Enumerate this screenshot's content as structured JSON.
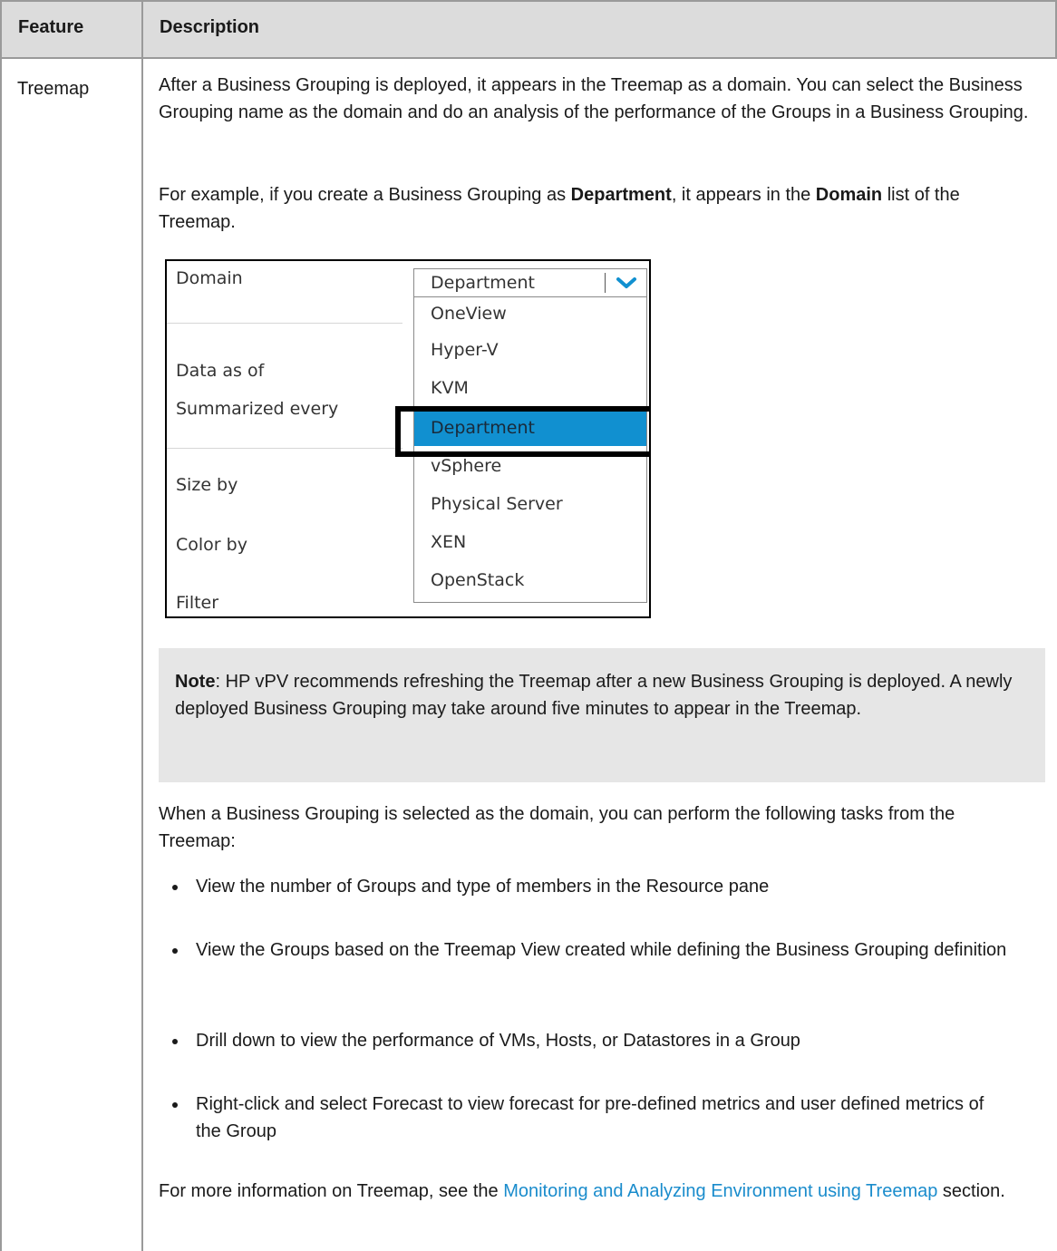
{
  "table": {
    "headers": [
      "Feature",
      "Description"
    ],
    "feature": "Treemap"
  },
  "paragraphs": {
    "p1": "After a Business Grouping is deployed, it appears in the Treemap as a domain. You can select the Business Grouping name as the domain and do an analysis of the performance of the Groups in a Business Grouping.",
    "p2_pre": "For example, if you create a Business Grouping as ",
    "p2_b1": "Department",
    "p2_mid": ", it appears in the ",
    "p2_b2": "Domain",
    "p2_post": " list of the Treemap.",
    "p3": "When a Business Grouping is selected as the domain, you can perform the following tasks from the Treemap:",
    "p4_pre": "For more information on Treemap, see the ",
    "p4_link": "Monitoring and Analyzing Environment using Treemap",
    "p4_post": " section."
  },
  "screenshot": {
    "labels": [
      "Domain",
      "Data as of",
      "Summarized every",
      "Size by",
      "Color by",
      "Filter"
    ],
    "selected_value": "Department",
    "options": [
      "OneView",
      "Hyper-V",
      "KVM",
      "Department",
      "vSphere",
      "Physical Server",
      "XEN",
      "OpenStack"
    ],
    "highlighted_option": "Department",
    "highlight_color": "#1190d0"
  },
  "note": {
    "label": "Note",
    "text": ": HP vPV recommends refreshing the Treemap after a new Business Grouping is deployed. A newly deployed Business Grouping may take around five minutes to appear in the Treemap."
  },
  "bullets": [
    "View the number of Groups and type of members in the Resource pane",
    "View the Groups based on the Treemap View created while defining the Business Grouping definition",
    "Drill down to view the performance of VMs, Hosts, or Datastores in a Group",
    "Right-click and select Forecast to view forecast for pre-defined metrics and user defined metrics of the Group"
  ],
  "colors": {
    "header_bg": "#dcdcdc",
    "link": "#1a8ccc",
    "note_bg": "#e6e6e6"
  }
}
